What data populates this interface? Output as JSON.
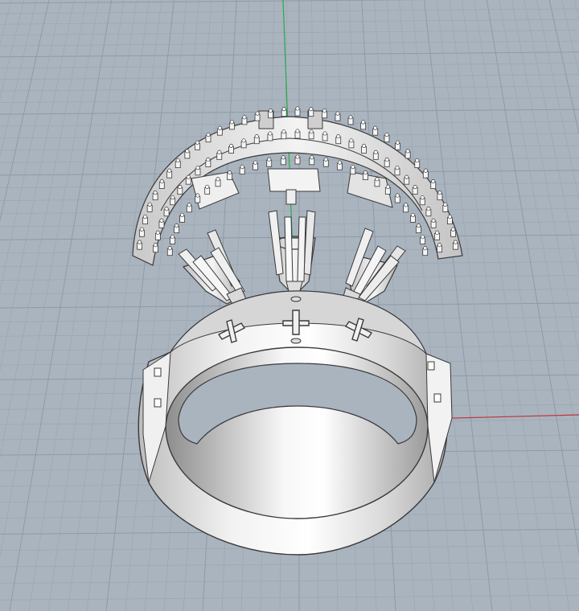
{
  "viewport": {
    "name": "Perspective",
    "background_color": "#a9b4bf",
    "grid_minor_color": "#9ba6b1",
    "grid_major_color": "#8f9aa6",
    "axis_x_color": "#c0343a",
    "axis_y_color": "#2aa84a",
    "show_grid": true,
    "show_axes": true
  },
  "model": {
    "parts": [
      "pave-halo-top-band",
      "center-prong-setting",
      "left-prong-setting",
      "right-prong-setting",
      "ring-shank"
    ],
    "material_color": "#e6e6e6",
    "edge_color": "#3a3a3a"
  }
}
